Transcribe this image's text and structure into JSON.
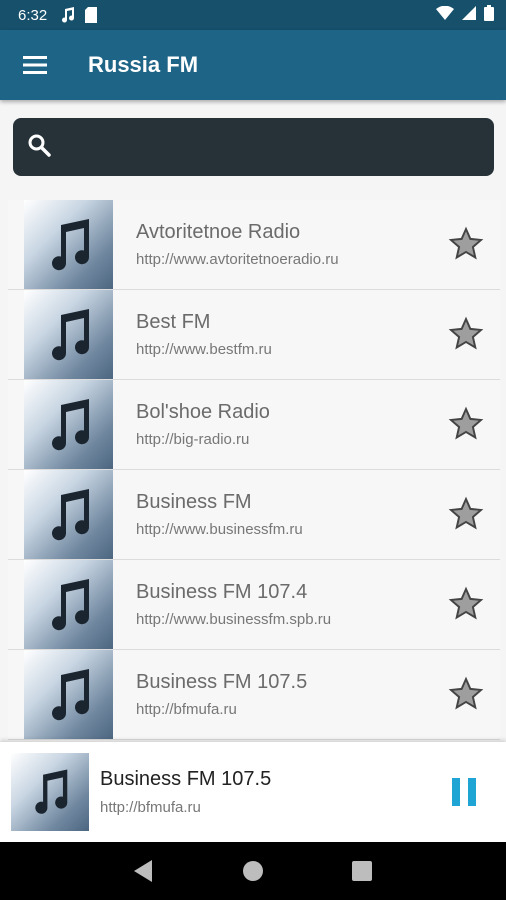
{
  "status_bar": {
    "time": "6:32",
    "icons": [
      "music-note-icon",
      "sd-card-icon",
      "wifi-icon",
      "signal-icon",
      "battery-icon"
    ]
  },
  "app_bar": {
    "title": "Russia FM",
    "menu_icon": "hamburger-menu-icon"
  },
  "search": {
    "placeholder": "",
    "value": "",
    "icon": "search-icon"
  },
  "stations": [
    {
      "name": "Avtoritetnoe Radio",
      "url": "http://www.avtoritetnoeradio.ru"
    },
    {
      "name": "Best FM",
      "url": "http://www.bestfm.ru"
    },
    {
      "name": "Bol'shoe Radio",
      "url": "http://big-radio.ru"
    },
    {
      "name": "Business FM",
      "url": "http://www.businessfm.ru"
    },
    {
      "name": "Business FM 107.4",
      "url": "http://www.businessfm.spb.ru"
    },
    {
      "name": "Business FM 107.5",
      "url": "http://bfmufa.ru"
    }
  ],
  "now_playing": {
    "title": "Business FM 107.5",
    "url": "http://bfmufa.ru",
    "state_icon": "pause-icon"
  },
  "colors": {
    "status_bar": "#16506b",
    "app_bar": "#1d6486",
    "search_bg": "#263238",
    "accent": "#1fa5d3"
  },
  "nav": [
    "back-icon",
    "home-icon",
    "recents-icon"
  ]
}
